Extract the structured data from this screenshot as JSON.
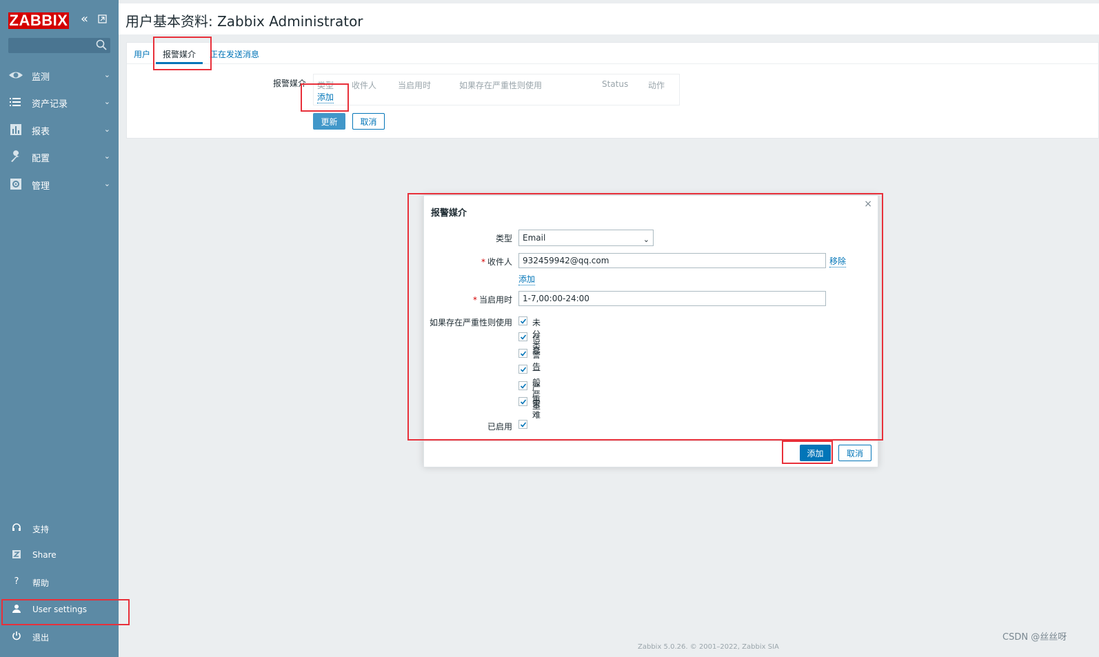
{
  "sidebar": {
    "logo": "ZABBIX",
    "search_placeholder": "",
    "menu": [
      {
        "label": "监测",
        "icon": "eye-icon"
      },
      {
        "label": "资产记录",
        "icon": "list-icon"
      },
      {
        "label": "报表",
        "icon": "bar-chart-icon"
      },
      {
        "label": "配置",
        "icon": "wrench-icon"
      },
      {
        "label": "管理",
        "icon": "gear-icon"
      }
    ],
    "bottom": [
      {
        "label": "支持",
        "icon": "headset-icon"
      },
      {
        "label": "Share",
        "icon": "share-z-icon"
      },
      {
        "label": "帮助",
        "icon": "help-icon"
      },
      {
        "label": "User settings",
        "icon": "user-icon"
      },
      {
        "label": "退出",
        "icon": "power-icon"
      }
    ]
  },
  "header": {
    "title": "用户基本资料: Zabbix Administrator"
  },
  "tabs": [
    {
      "label": "用户"
    },
    {
      "label": "报警媒介"
    },
    {
      "label": "正在发送消息"
    }
  ],
  "media": {
    "label": "报警媒介",
    "columns": [
      "类型",
      "收件人",
      "当启用时",
      "如果存在严重性则使用",
      "Status",
      "动作"
    ],
    "add_link": "添加",
    "update_button": "更新",
    "cancel_button": "取消"
  },
  "modal": {
    "title": "报警媒介",
    "close": "×",
    "type_label": "类型",
    "type_value": "Email",
    "sendto_label": "收件人",
    "sendto_value": "932459942@qq.com",
    "remove_link": "移除",
    "add_link": "添加",
    "when_active_label": "当启用时",
    "when_active_value": "1-7,00:00-24:00",
    "severity_label": "如果存在严重性则使用",
    "severities": [
      "未分类",
      "信息",
      "警告",
      "一般严重",
      "严重",
      "灾难"
    ],
    "enabled_label": "已启用",
    "add_button": "添加",
    "cancel_button": "取消"
  },
  "footer": {
    "credit": "CSDN @丝丝呀",
    "version": "Zabbix 5.0.26. © 2001–2022, Zabbix SIA"
  },
  "colors": {
    "sidebar": "#5c8aa5",
    "accent": "#0275b8",
    "highlight": "#e8303a"
  }
}
